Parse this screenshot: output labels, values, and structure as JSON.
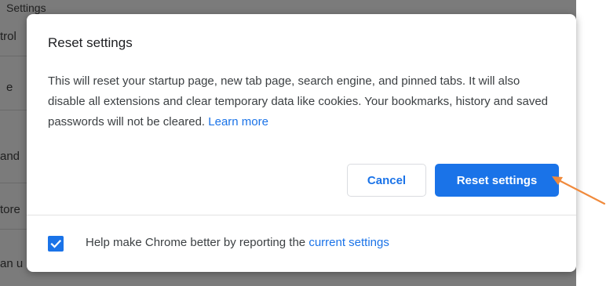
{
  "background": {
    "texts": [
      "Settings",
      "trol",
      "e",
      "and",
      "tore",
      "an u"
    ]
  },
  "dialog": {
    "title": "Reset settings",
    "body_text": "This will reset your startup page, new tab page, search engine, and pinned tabs. It will also disable all extensions and clear temporary data like cookies. Your bookmarks, history and saved passwords will not be cleared. ",
    "learn_more_label": "Learn more",
    "cancel_label": "Cancel",
    "reset_label": "Reset settings",
    "checkbox_checked": true,
    "checkbox_text": "Help make Chrome better by reporting the ",
    "checkbox_link": "current settings"
  },
  "colors": {
    "accent": "#1a73e8",
    "annotation_arrow": "#f08a3c"
  },
  "icons": {
    "checkbox": "checkmark-icon",
    "annotation": "arrow-icon"
  }
}
